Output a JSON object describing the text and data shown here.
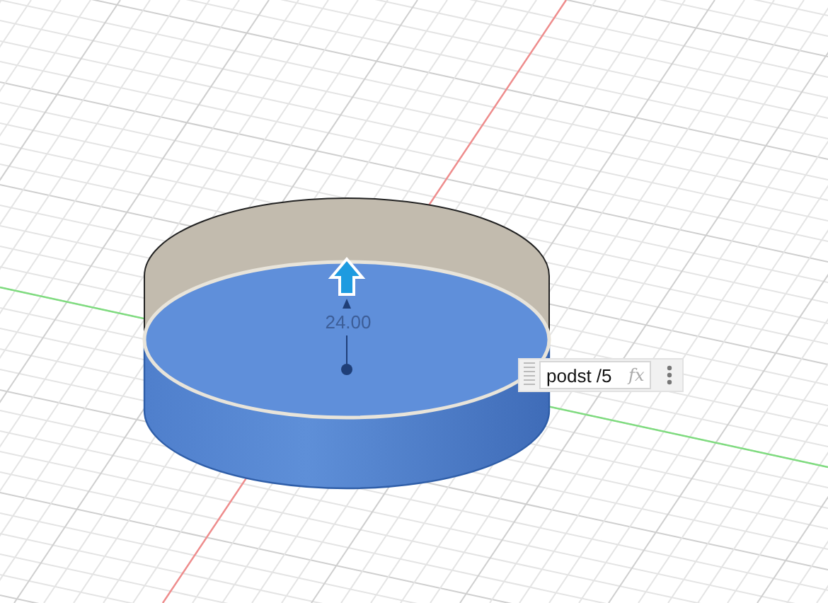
{
  "viewport": {
    "dimension_label": "24.00",
    "expression_input": {
      "value": "podst /5",
      "suffix": "fx"
    }
  }
}
